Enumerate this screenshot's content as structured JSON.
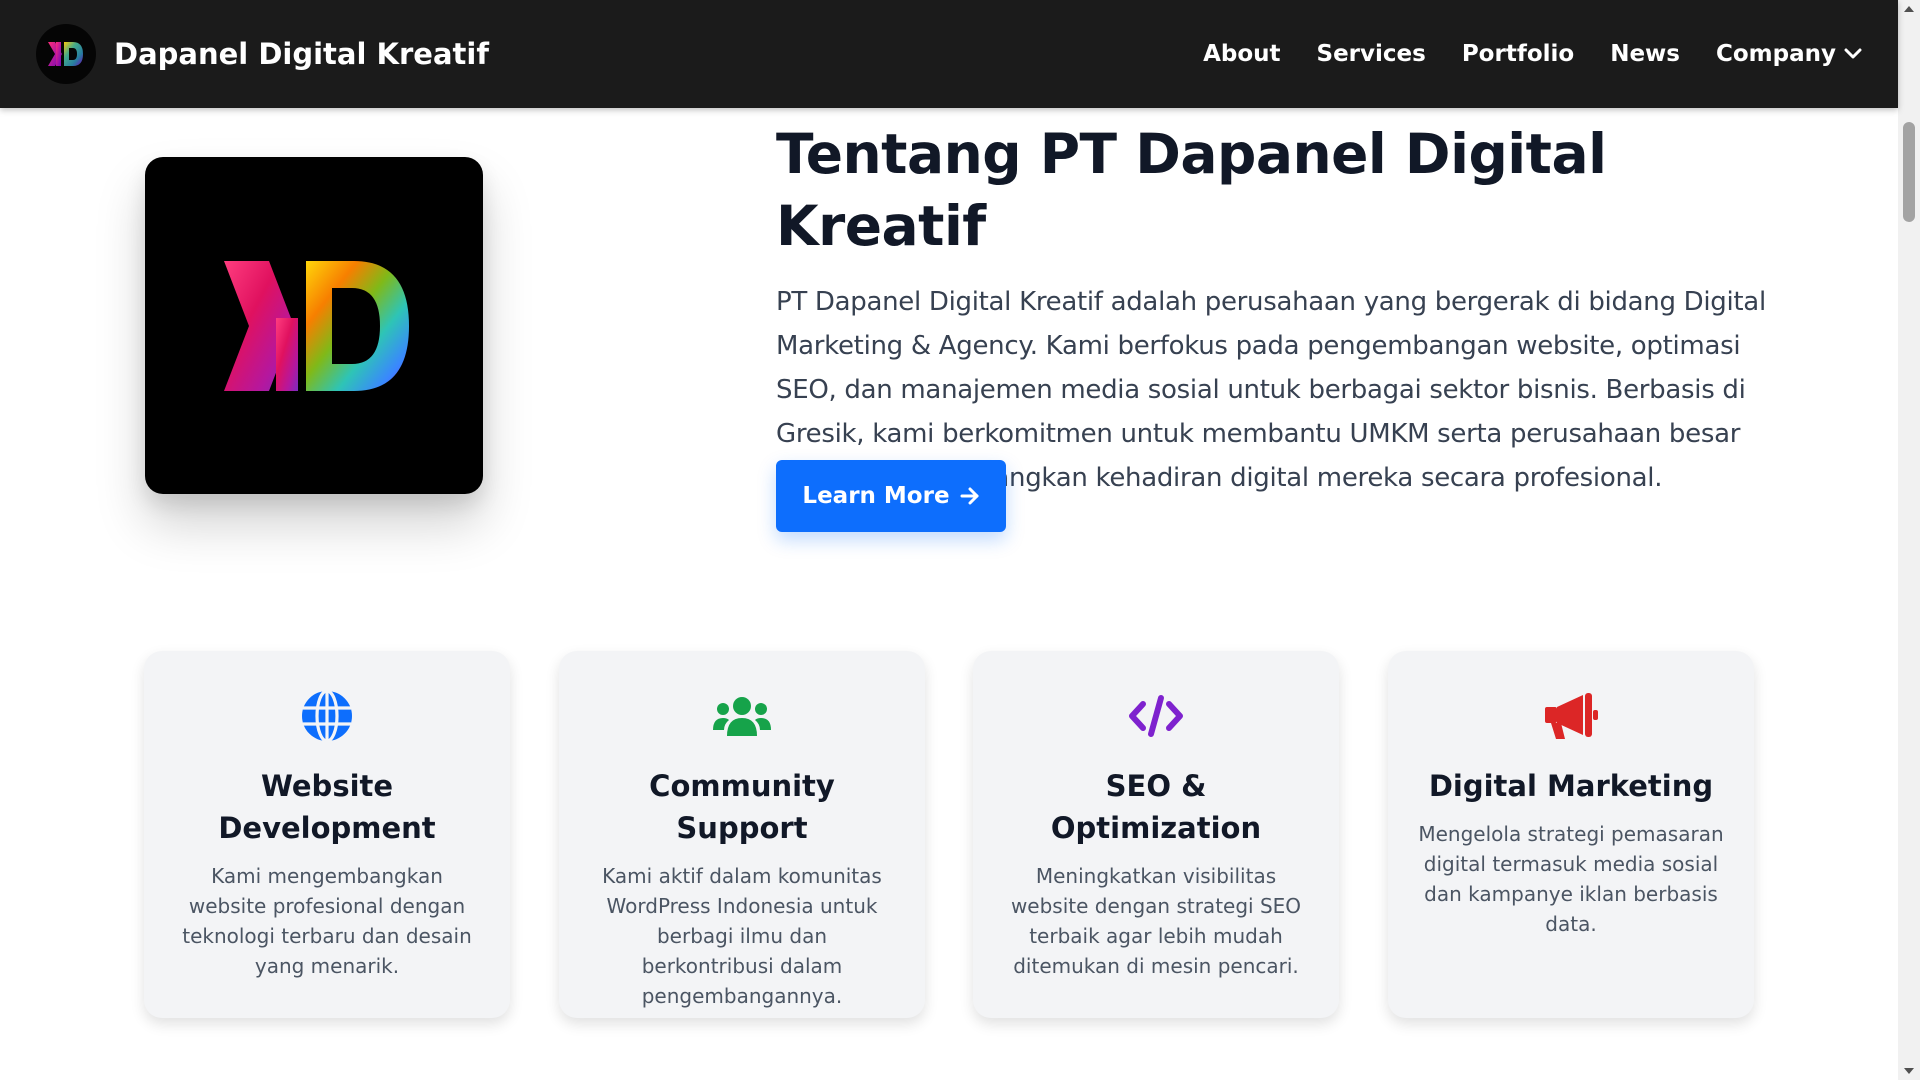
{
  "brand": {
    "name": "Dapanel Digital Kreatif",
    "logo_text": "KD"
  },
  "nav": {
    "items": [
      {
        "label": "About"
      },
      {
        "label": "Services"
      },
      {
        "label": "Portfolio"
      },
      {
        "label": "News"
      },
      {
        "label": "Company",
        "dropdown": true
      }
    ]
  },
  "hero": {
    "title": "Tentang PT Dapanel Digital Kreatif",
    "description": "PT Dapanel Digital Kreatif adalah perusahaan yang bergerak di bidang Digital Marketing & Agency. Kami berfokus pada pengembangan website, optimasi SEO, dan manajemen media sosial untuk berbagai sektor bisnis. Berbasis di Gresik, kami berkomitmen untuk membantu UMKM serta perusahaan besar dalam mengembangkan kehadiran digital mereka secara profesional.",
    "button_label": "Learn More"
  },
  "features": [
    {
      "icon": "globe-icon",
      "color": "#0d6efd",
      "title": "Website Development",
      "description": "Kami mengembangkan website profesional dengan teknologi terbaru dan desain yang menarik."
    },
    {
      "icon": "users-icon",
      "color": "#16a34a",
      "title": "Community Support",
      "description": "Kami aktif dalam komunitas WordPress Indonesia untuk berbagi ilmu dan berkontribusi dalam pengembangannya."
    },
    {
      "icon": "code-icon",
      "color": "#7e22ce",
      "title": "SEO & Optimization",
      "description": "Meningkatkan visibilitas website dengan strategi SEO terbaik agar lebih mudah ditemukan di mesin pencari."
    },
    {
      "icon": "megaphone-icon",
      "color": "#dc2626",
      "title": "Digital Marketing",
      "description": "Mengelola strategi pemasaran digital termasuk media sosial dan kampanye iklan berbasis data."
    }
  ],
  "colors": {
    "navbar": "#1b1b1b",
    "primary": "#0d6efd",
    "card_bg": "#f3f4f6"
  }
}
